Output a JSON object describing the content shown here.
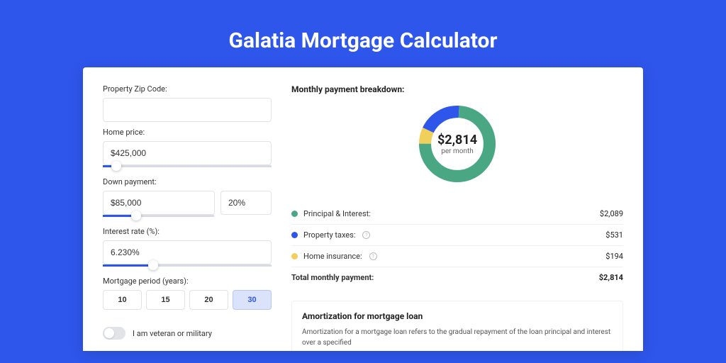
{
  "page_title": "Galatia Mortgage Calculator",
  "form": {
    "zip_label": "Property Zip Code:",
    "zip_value": "",
    "home_price_label": "Home price:",
    "home_price_value": "$425,000",
    "home_price_slider_pct": 8,
    "down_payment_label": "Down payment:",
    "down_payment_amount": "$85,000",
    "down_payment_pct": "20%",
    "down_payment_slider_pct": 20,
    "interest_label": "Interest rate (%):",
    "interest_value": "6.230%",
    "interest_slider_pct": 30,
    "period_label": "Mortgage period (years):",
    "periods": [
      "10",
      "15",
      "20",
      "30"
    ],
    "period_selected": "30",
    "veteran_label": "I am veteran or military",
    "veteran_on": false
  },
  "breakdown": {
    "title": "Monthly payment breakdown:",
    "total_display": "$2,814",
    "total_sub": "per month",
    "items": [
      {
        "label": "Principal & Interest:",
        "value": "$2,089",
        "color": "#4aa784",
        "info": false,
        "share": 0.742
      },
      {
        "label": "Property taxes:",
        "value": "$531",
        "color": "#2e56eb",
        "info": true,
        "share": 0.189
      },
      {
        "label": "Home insurance:",
        "value": "$194",
        "color": "#f0cf5b",
        "info": true,
        "share": 0.069
      }
    ],
    "total_label": "Total monthly payment:",
    "total_value": "$2,814"
  },
  "amortization": {
    "title": "Amortization for mortgage loan",
    "text": "Amortization for a mortgage loan refers to the gradual repayment of the loan principal and interest over a specified"
  },
  "chart_data": {
    "type": "pie",
    "title": "Monthly payment breakdown",
    "series": [
      {
        "name": "Principal & Interest",
        "value": 2089,
        "color": "#4aa784"
      },
      {
        "name": "Property taxes",
        "value": 531,
        "color": "#2e56eb"
      },
      {
        "name": "Home insurance",
        "value": 194,
        "color": "#f0cf5b"
      }
    ],
    "total": 2814,
    "unit": "USD per month"
  }
}
